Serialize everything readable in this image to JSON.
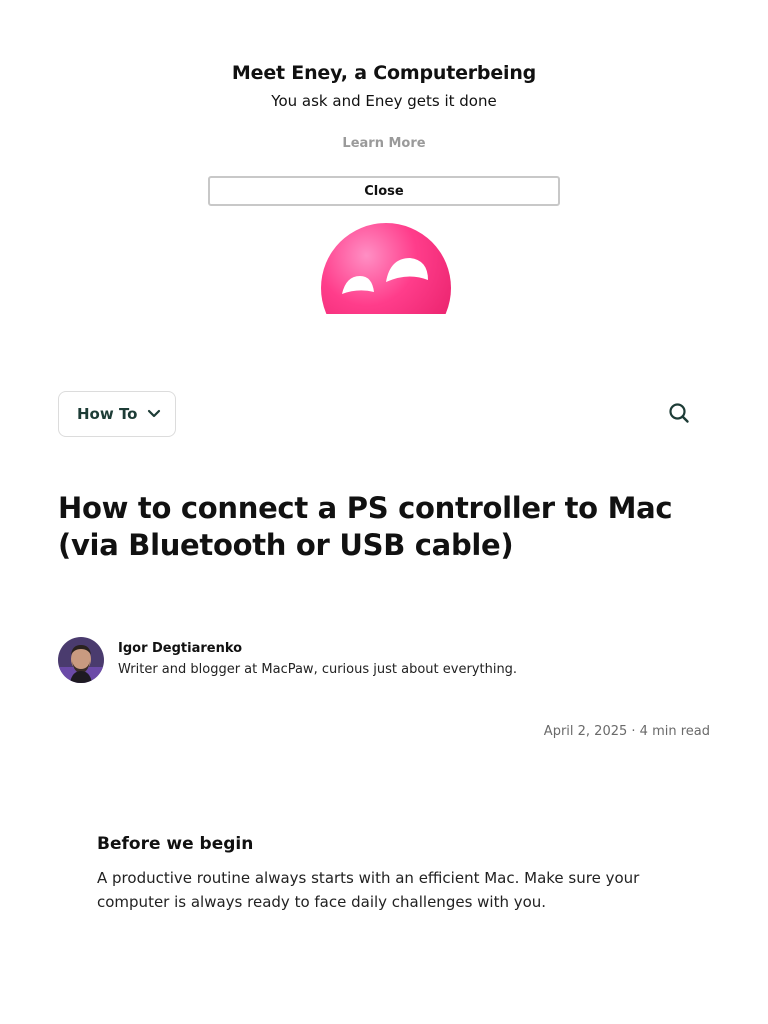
{
  "promo": {
    "title": "Meet Eney, a Computerbeing",
    "subtitle": "You ask and Eney gets it done",
    "learn_more": "Learn More",
    "close": "Close",
    "mascot_color": "#ff3d8b"
  },
  "nav": {
    "category_label": "How To",
    "category_icon": "chevron-down-icon",
    "search_icon": "search-icon",
    "accent_color": "#1d3c36"
  },
  "article": {
    "title": "How to connect a PS controller to Mac (via Bluetooth or USB cable)",
    "author": {
      "name": "Igor Degtiarenko",
      "bio": "Writer and blogger at MacPaw, curious just about everything."
    },
    "meta": "April 2, 2025 · 4 min read",
    "before": {
      "title": "Before we begin",
      "text": "A productive routine always starts with an efficient Mac. Make sure your computer is always ready to face daily challenges with you."
    }
  }
}
